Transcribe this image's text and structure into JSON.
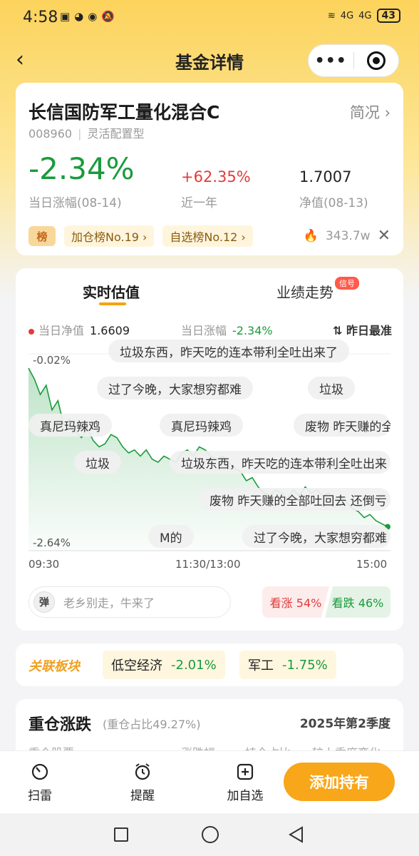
{
  "status": {
    "time": "4:58",
    "battery": "43",
    "net1": "4G",
    "net2": "4G"
  },
  "nav": {
    "title": "基金详情"
  },
  "fund": {
    "name": "长信国防军工量化混合C",
    "brief_label": "简况",
    "code": "008960",
    "type": "灵活配置型",
    "day_change": "-2.34%",
    "day_change_label": "当日涨幅(08-14)",
    "year_change": "+62.35%",
    "year_label": "近一年",
    "nav": "1.7007",
    "nav_label": "净值(08-13)",
    "rank_badge": "榜",
    "tag1": "加仓榜No.19 ›",
    "tag2": "自选榜No.12 ›",
    "heat": "343.7w"
  },
  "chart_tabs": {
    "tab1": "实时估值",
    "tab2": "业绩走势",
    "badge": "信号"
  },
  "legend": {
    "nav_label": "当日净值",
    "nav_value": "1.6609",
    "chg_label": "当日涨幅",
    "chg_value": "-2.34%",
    "sort": "⇅ 昨日最准"
  },
  "axis": {
    "ytop": "-0.02%",
    "ybottom": "-2.64%",
    "x1": "09:30",
    "x2": "11:30/13:00",
    "x3": "15:00"
  },
  "danmu": [
    "垃圾东西，昨天吃的连本带利全吐出来了",
    "过了今晚，大家想穷都难",
    "垃圾",
    "真尼玛辣鸡",
    "真尼玛辣鸡",
    "废物 昨天赚的全",
    "垃圾",
    "垃圾东西，昨天吃的连本带利全吐出来",
    "废物 昨天赚的全部吐回去 还倒亏",
    "M的",
    "过了今晚，大家想穷都难"
  ],
  "danmu_input": {
    "icon": "弹",
    "placeholder": "老乡别走，牛来了"
  },
  "vote": {
    "up": "看涨 54%",
    "down": "看跌 46%"
  },
  "sector": {
    "logo": "关联板块",
    "items": [
      {
        "name": "低空经济",
        "value": "-2.01%"
      },
      {
        "name": "军工",
        "value": "-1.75%"
      }
    ]
  },
  "holdings": {
    "title": "重仓涨跌",
    "ratio": "(重仓占比49.27%)",
    "quarter": "2025年第2季度",
    "cols": [
      "重仓股票",
      "涨跌幅",
      "持仓占比",
      "较上季度变化"
    ]
  },
  "bottom": {
    "scan": "扫雷",
    "remind": "提醒",
    "add_fav": "加自选",
    "add_hold": "添加持有"
  },
  "colors": {
    "accent": "#f8a61a",
    "down": "#1a9b3c",
    "up": "#e23b3b"
  },
  "chart_data": {
    "type": "line",
    "x_labels": [
      "09:30",
      "11:30/13:00",
      "15:00"
    ],
    "ylim": [
      -2.64,
      -0.02
    ],
    "series": [
      {
        "values": [
          -0.02,
          -0.2,
          -0.45,
          -0.3,
          -0.7,
          -0.55,
          -0.95,
          -0.85,
          -1.05,
          -1.15,
          -1.0,
          -1.2,
          -1.3,
          -1.25,
          -1.1,
          -1.15,
          -1.3,
          -1.4,
          -1.35,
          -1.45,
          -1.35,
          -1.5,
          -1.55,
          -1.45,
          -1.5,
          -1.55,
          -1.4,
          -1.35,
          -1.45,
          -1.3,
          -1.35,
          -1.45,
          -1.5,
          -1.45,
          -1.55,
          -1.65,
          -1.7,
          -1.85,
          -1.8,
          -1.95,
          -2.05,
          -2.1,
          -2.0,
          -2.05,
          -2.15,
          -2.0,
          -2.1,
          -1.95,
          -2.05,
          -2.0,
          -2.1,
          -2.05,
          -2.15,
          -2.1,
          -2.2,
          -2.3,
          -2.35,
          -2.45,
          -2.4,
          -2.5,
          -2.55,
          -2.6
        ]
      }
    ]
  }
}
